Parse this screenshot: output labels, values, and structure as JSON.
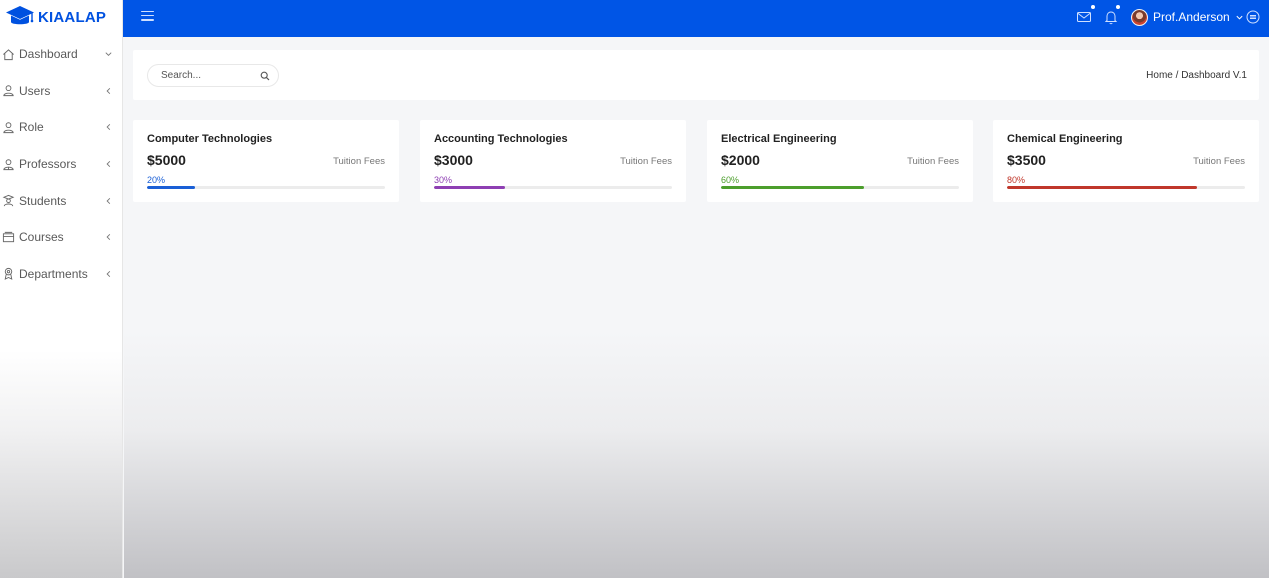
{
  "app": {
    "logo_text": "KIAALAP"
  },
  "sidebar": {
    "items": [
      {
        "label": "Dashboard",
        "icon": "home-icon",
        "chevron": "down"
      },
      {
        "label": "Users",
        "icon": "user-icon",
        "chevron": "left"
      },
      {
        "label": "Role",
        "icon": "role-icon",
        "chevron": "left"
      },
      {
        "label": "Professors",
        "icon": "professor-icon",
        "chevron": "left"
      },
      {
        "label": "Students",
        "icon": "student-icon",
        "chevron": "left"
      },
      {
        "label": "Courses",
        "icon": "courses-icon",
        "chevron": "left"
      },
      {
        "label": "Departments",
        "icon": "department-icon",
        "chevron": "left"
      }
    ]
  },
  "topbar": {
    "user_name": "Prof.Anderson",
    "icons": [
      "menu-icon",
      "mail-icon",
      "bell-icon",
      "avatar",
      "chevron-down-icon",
      "settings-icon"
    ],
    "color": "#0055e6"
  },
  "header": {
    "search_placeholder": "Search...",
    "breadcrumb_home": "Home",
    "breadcrumb_sep": " / ",
    "breadcrumb_current": "Dashboard V.1"
  },
  "cards": [
    {
      "title": "Computer Technologies",
      "amount": "$5000",
      "caption": "Tuition Fees",
      "percent_label": "20%",
      "progress": 0.2,
      "color": "#1a5fd6"
    },
    {
      "title": "Accounting Technologies",
      "amount": "$3000",
      "caption": "Tuition Fees",
      "percent_label": "30%",
      "progress": 0.3,
      "color": "#8e3fb3"
    },
    {
      "title": "Electrical Engineering",
      "amount": "$2000",
      "caption": "Tuition Fees",
      "percent_label": "60%",
      "progress": 0.6,
      "color": "#4c9e2c"
    },
    {
      "title": "Chemical Engineering",
      "amount": "$3500",
      "caption": "Tuition Fees",
      "percent_label": "80%",
      "progress": 0.8,
      "color": "#c0372b"
    }
  ]
}
